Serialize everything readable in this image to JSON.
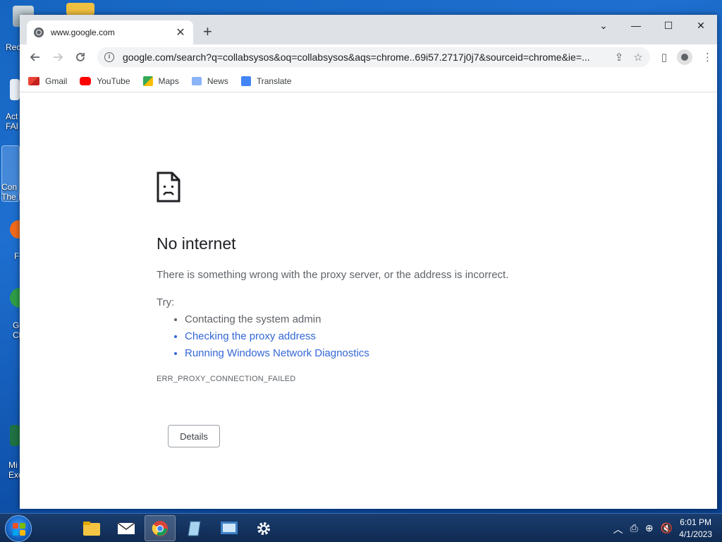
{
  "desktop": {
    "icons": [
      {
        "label": "Rec",
        "name": "recycle-bin"
      },
      {
        "label": "Act\nFAI",
        "name": "act-fai-shortcut"
      },
      {
        "label": "Con\nThe I",
        "name": "con-shortcut"
      },
      {
        "label": "F",
        "name": "f-shortcut"
      },
      {
        "label": "G\nCl",
        "name": "g-shortcut"
      },
      {
        "label": "Mi\nExc",
        "name": "excel-shortcut"
      }
    ]
  },
  "browser": {
    "tab": {
      "title": "www.google.com",
      "close": "✕"
    },
    "new_tab": "+",
    "window_buttons": {
      "dropdown": "⌄",
      "minimize": "—",
      "maximize": "☐",
      "close": "✕"
    },
    "address": {
      "url": "google.com/search?q=collabsysos&oq=collabsysos&aqs=chrome..69i57.2717j0j7&sourceid=chrome&ie=..."
    },
    "bookmarks": [
      {
        "label": "Gmail",
        "color": "#ea4335"
      },
      {
        "label": "YouTube",
        "color": "#ff0000"
      },
      {
        "label": "Maps",
        "color": "#34a853"
      },
      {
        "label": "News",
        "color": "#4285f4"
      },
      {
        "label": "Translate",
        "color": "#4285f4"
      }
    ]
  },
  "error_page": {
    "title": "No internet",
    "description": "There is something wrong with the proxy server, or the address is incorrect.",
    "try_label": "Try:",
    "suggestions": [
      {
        "text": "Contacting the system admin",
        "link": false
      },
      {
        "text": "Checking the proxy address",
        "link": true
      },
      {
        "text": "Running Windows Network Diagnostics",
        "link": true
      }
    ],
    "error_code": "ERR_PROXY_CONNECTION_FAILED",
    "details_button": "Details"
  },
  "taskbar": {
    "clock_time": "6:01 PM",
    "clock_date": "4/1/2023"
  }
}
